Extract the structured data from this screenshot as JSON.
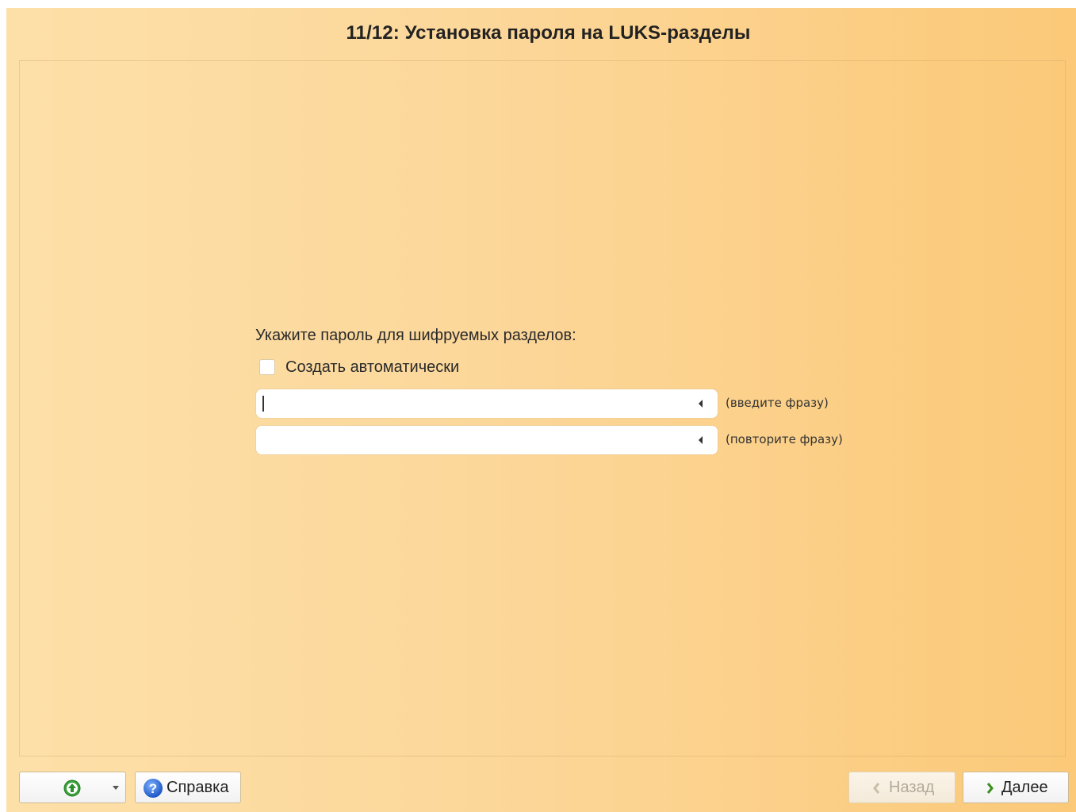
{
  "window": {
    "title": "11/12: Установка пароля на LUKS-разделы"
  },
  "form": {
    "prompt": "Укажите пароль для шифруемых разделов:",
    "auto_checkbox": {
      "label": "Создать автоматически",
      "checked": false
    },
    "passphrase": {
      "value": "",
      "hint": "(введите фразу)"
    },
    "passphrase_repeat": {
      "value": "",
      "hint": "(повторите фразу)"
    }
  },
  "footer": {
    "menu_button_icon": "green-up-arrow-icon",
    "help_label": "Справка",
    "help_icon": "question-mark-icon",
    "back_label": "Назад",
    "back_enabled": false,
    "next_label": "Далее"
  },
  "colors": {
    "background_left": "#fde0a8",
    "background_right": "#fbc978",
    "help_icon_blue": "#2f6fd6",
    "up_icon_green": "#3aa23a",
    "chevron_green": "#3c8f1e"
  }
}
